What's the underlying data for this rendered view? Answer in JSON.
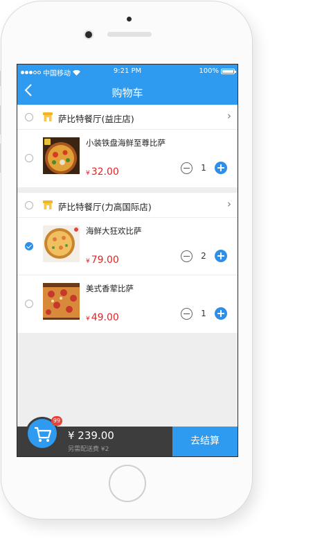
{
  "status_bar": {
    "carrier": "中国移动",
    "time": "9:21 PM",
    "battery": "100%"
  },
  "nav": {
    "title": "购物车",
    "back_icon": "chevron-left-icon"
  },
  "stores": [
    {
      "name": "萨比特餐厅(益庄店)",
      "checked": false,
      "items": [
        {
          "name": "小装铁盘海鲜至尊比萨",
          "currency": "¥",
          "price": "32.00",
          "quantity": "1",
          "checked": false
        }
      ]
    },
    {
      "name": "萨比特餐厅(力高国际店)",
      "checked": false,
      "items": [
        {
          "name": "海鲜大狂欢比萨",
          "currency": "¥",
          "price": "79.00",
          "quantity": "2",
          "checked": true
        },
        {
          "name": "美式香荤比萨",
          "currency": "¥",
          "price": "49.00",
          "quantity": "1",
          "checked": false
        }
      ]
    }
  ],
  "cart_bar": {
    "badge_count": "99",
    "total": "¥ 239.00",
    "delivery_note": "另需配送费 ¥2",
    "checkout_label": "去结算"
  },
  "colors": {
    "primary": "#2e9bf0",
    "price": "#e62222",
    "badge": "#e8423a",
    "bottom_bar": "#3d3d3d"
  }
}
